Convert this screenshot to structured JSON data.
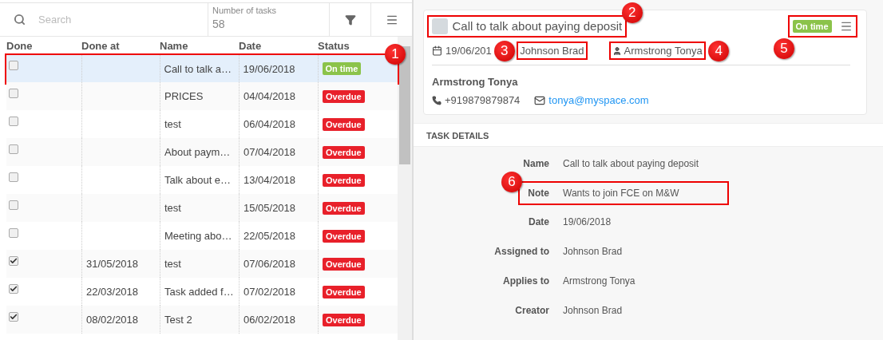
{
  "toolbar": {
    "search": {
      "placeholder": "Search"
    },
    "task_count": {
      "label": "Number of tasks",
      "value": "58"
    }
  },
  "table": {
    "columns": [
      "Done",
      "Done at",
      "Name",
      "Date",
      "Status"
    ],
    "rows": [
      {
        "done": false,
        "done_at": "",
        "name": "Call to talk a…",
        "date": "19/06/2018",
        "status": {
          "label": "On time",
          "kind": "on_time"
        },
        "selected": true
      },
      {
        "done": false,
        "done_at": "",
        "name": "PRICES",
        "date": "04/04/2018",
        "status": {
          "label": "Overdue",
          "kind": "overdue"
        },
        "selected": false
      },
      {
        "done": false,
        "done_at": "",
        "name": "test",
        "date": "06/04/2018",
        "status": {
          "label": "Overdue",
          "kind": "overdue"
        },
        "selected": false
      },
      {
        "done": false,
        "done_at": "",
        "name": "About paym…",
        "date": "07/04/2018",
        "status": {
          "label": "Overdue",
          "kind": "overdue"
        },
        "selected": false
      },
      {
        "done": false,
        "done_at": "",
        "name": "Talk about e…",
        "date": "13/04/2018",
        "status": {
          "label": "Overdue",
          "kind": "overdue"
        },
        "selected": false
      },
      {
        "done": false,
        "done_at": "",
        "name": "test",
        "date": "15/05/2018",
        "status": {
          "label": "Overdue",
          "kind": "overdue"
        },
        "selected": false
      },
      {
        "done": false,
        "done_at": "",
        "name": "Meeting abo…",
        "date": "22/05/2018",
        "status": {
          "label": "Overdue",
          "kind": "overdue"
        },
        "selected": false
      },
      {
        "done": true,
        "done_at": "31/05/2018",
        "name": "test",
        "date": "07/06/2018",
        "status": {
          "label": "Overdue",
          "kind": "overdue"
        },
        "selected": false
      },
      {
        "done": true,
        "done_at": "22/03/2018",
        "name": "Task added f…",
        "date": "07/02/2018",
        "status": {
          "label": "Overdue",
          "kind": "overdue"
        },
        "selected": false
      },
      {
        "done": true,
        "done_at": "08/02/2018",
        "name": "Test 2",
        "date": "06/02/2018",
        "status": {
          "label": "Overdue",
          "kind": "overdue"
        },
        "selected": false
      }
    ]
  },
  "task_card": {
    "done": false,
    "title": "Call to talk about paying deposit",
    "status": {
      "label": "On time",
      "kind": "on_time"
    },
    "date": "19/06/201",
    "assignee": "Johnson Brad",
    "contact": "Armstrong Tonya",
    "contact_name": "Armstrong Tonya",
    "phone": "+919879879874",
    "email": "tonya@myspace.com"
  },
  "task_details": {
    "heading": "TASK DETAILS",
    "fields": [
      {
        "label": "Name",
        "value": "Call to talk about paying deposit"
      },
      {
        "label": "Note",
        "value": "Wants to join FCE on M&W"
      },
      {
        "label": "Date",
        "value": "19/06/2018"
      },
      {
        "label": "Assigned to",
        "value": "Johnson Brad"
      },
      {
        "label": "Applies to",
        "value": "Armstrong Tonya"
      },
      {
        "label": "Creator",
        "value": "Johnson Brad"
      }
    ]
  },
  "callouts": [
    "1",
    "2",
    "3",
    "4",
    "5",
    "6"
  ]
}
